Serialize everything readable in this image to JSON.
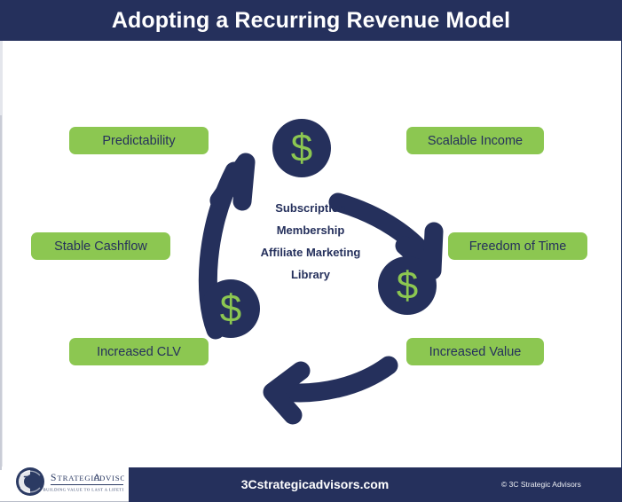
{
  "header": {
    "title": "Adopting a Recurring Revenue Model"
  },
  "diagram": {
    "center_lines": [
      "Subscription",
      "Membership",
      "Affiliate Marketing",
      "Library"
    ],
    "labels": [
      {
        "id": "predictability",
        "text": "Predictability"
      },
      {
        "id": "scalable_income",
        "text": "Scalable Income"
      },
      {
        "id": "stable_cashflow",
        "text": "Stable Cashflow"
      },
      {
        "id": "freedom_of_time",
        "text": "Freedom of Time"
      },
      {
        "id": "increased_clv",
        "text": "Increased CLV"
      },
      {
        "id": "increased_value",
        "text": "Increased Value"
      }
    ],
    "nodes": [
      {
        "id": "node_top",
        "icon": "dollar-sign-icon",
        "glyph": "$"
      },
      {
        "id": "node_right",
        "icon": "dollar-sign-icon",
        "glyph": "$"
      },
      {
        "id": "node_left",
        "icon": "dollar-sign-icon",
        "glyph": "$"
      }
    ],
    "arrows": [
      {
        "id": "arrow_right_down",
        "icon": "curved-arrow-down-right-icon"
      },
      {
        "id": "arrow_bottom_left",
        "icon": "curved-arrow-left-icon"
      },
      {
        "id": "arrow_left_up",
        "icon": "curved-arrow-up-right-icon"
      }
    ]
  },
  "footer": {
    "website": "3Cstrategicadvisors.com",
    "copyright": "© 3C Strategic Advisors"
  },
  "logo": {
    "mark": "3c-monogram-icon",
    "name": "Strategic Advisors",
    "tagline": "Building Value to Last a Lifetime"
  },
  "colors": {
    "navy": "#25305c",
    "green": "#8cc751",
    "white": "#ffffff"
  }
}
